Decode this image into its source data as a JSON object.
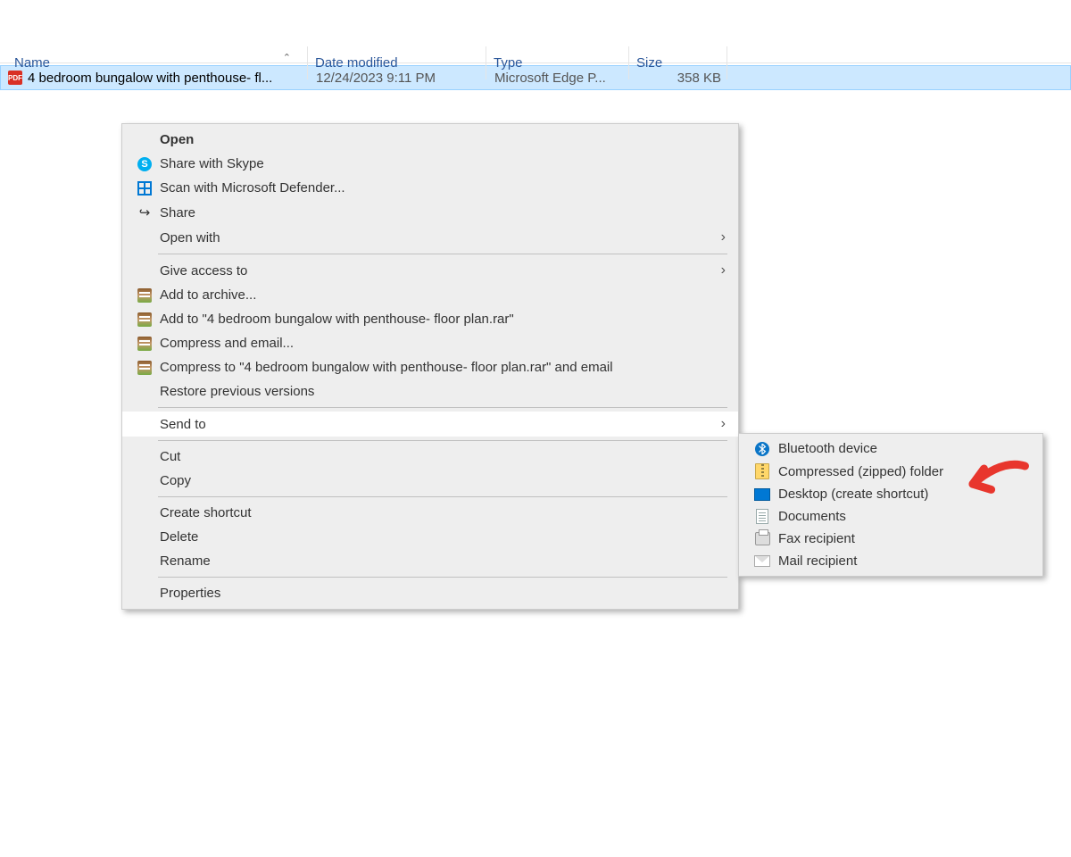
{
  "columns": {
    "name": "Name",
    "date": "Date modified",
    "type": "Type",
    "size": "Size"
  },
  "file": {
    "name": "4 bedroom bungalow with penthouse- fl...",
    "date": "12/24/2023 9:11 PM",
    "type": "Microsoft Edge P...",
    "size": "358 KB"
  },
  "context_menu": {
    "open": "Open",
    "share_skype": "Share with Skype",
    "defender": "Scan with Microsoft Defender...",
    "share": "Share",
    "open_with": "Open with",
    "give_access": "Give access to",
    "add_archive": "Add to archive...",
    "add_rar": "Add to \"4 bedroom bungalow with penthouse- floor plan.rar\"",
    "compress_email": "Compress and email...",
    "compress_rar_email": "Compress to \"4 bedroom bungalow with penthouse- floor plan.rar\" and email",
    "restore": "Restore previous versions",
    "send_to": "Send to",
    "cut": "Cut",
    "copy": "Copy",
    "create_shortcut": "Create shortcut",
    "delete": "Delete",
    "rename": "Rename",
    "properties": "Properties"
  },
  "send_to_menu": {
    "bluetooth": "Bluetooth device",
    "zipped": "Compressed (zipped) folder",
    "desktop": "Desktop (create shortcut)",
    "documents": "Documents",
    "fax": "Fax recipient",
    "mail": "Mail recipient"
  }
}
